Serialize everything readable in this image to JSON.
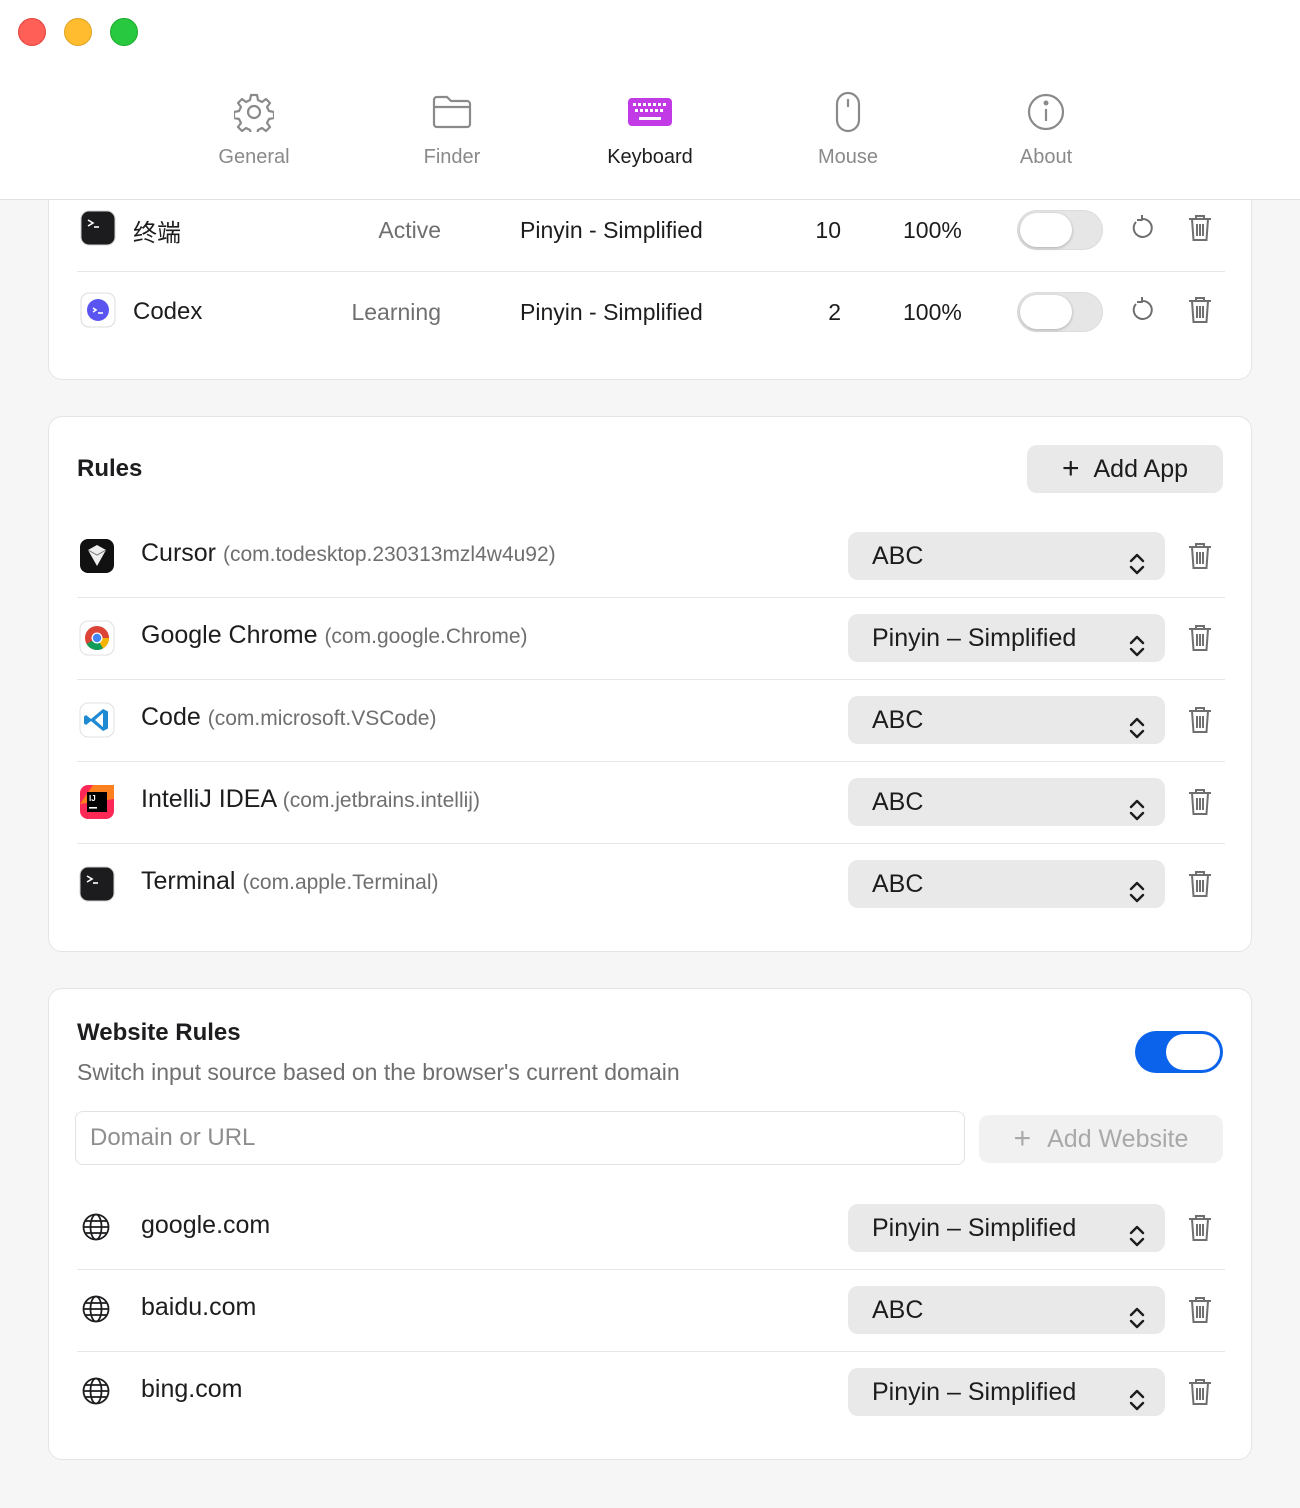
{
  "window": {
    "tabs": [
      {
        "label": "General",
        "icon": "gear-icon",
        "active": false
      },
      {
        "label": "Finder",
        "icon": "folder-icon",
        "active": false
      },
      {
        "label": "Keyboard",
        "icon": "keyboard-icon",
        "active": true
      },
      {
        "label": "Mouse",
        "icon": "mouse-icon",
        "active": false
      },
      {
        "label": "About",
        "icon": "info-icon",
        "active": false
      }
    ]
  },
  "stats": {
    "rows": [
      {
        "name": "终端",
        "status": "Active",
        "source": "Pinyin - Simplified",
        "count": "10",
        "percent": "100%",
        "enabled": false
      },
      {
        "name": "Codex",
        "status": "Learning",
        "source": "Pinyin - Simplified",
        "count": "2",
        "percent": "100%",
        "enabled": false
      }
    ]
  },
  "rules": {
    "title": "Rules",
    "add_label": "Add App",
    "items": [
      {
        "name": "Cursor",
        "bundle": "(com.todesktop.230313mzl4w4u92)",
        "source": "ABC",
        "icon": "cursor-app-icon"
      },
      {
        "name": "Google Chrome",
        "bundle": "(com.google.Chrome)",
        "source": "Pinyin – Simplified",
        "icon": "chrome-app-icon"
      },
      {
        "name": "Code",
        "bundle": "(com.microsoft.VSCode)",
        "source": "ABC",
        "icon": "vscode-app-icon"
      },
      {
        "name": "IntelliJ IDEA",
        "bundle": "(com.jetbrains.intellij)",
        "source": "ABC",
        "icon": "intellij-app-icon"
      },
      {
        "name": "Terminal",
        "bundle": "(com.apple.Terminal)",
        "source": "ABC",
        "icon": "terminal-app-icon"
      }
    ]
  },
  "website_rules": {
    "title": "Website Rules",
    "subtitle": "Switch input source based on the browser's current domain",
    "enabled": true,
    "input_placeholder": "Domain or URL",
    "add_label": "Add Website",
    "items": [
      {
        "domain": "google.com",
        "source": "Pinyin – Simplified"
      },
      {
        "domain": "baidu.com",
        "source": "ABC"
      },
      {
        "domain": "bing.com",
        "source": "Pinyin – Simplified"
      }
    ]
  },
  "colors": {
    "accent": "#0a63ea",
    "keyboard_icon": "#c23ae6",
    "close": "#ff5f57",
    "minimize": "#febc2e",
    "zoom": "#28c840"
  }
}
